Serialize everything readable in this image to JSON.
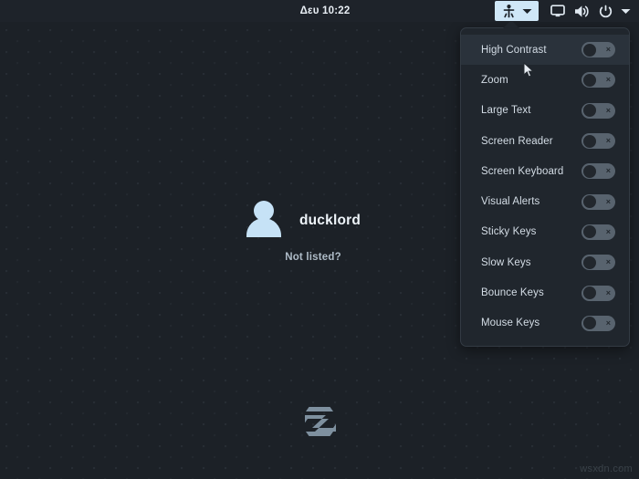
{
  "topbar": {
    "clock": "Δευ 10:22",
    "accessibility_button": {
      "icon": "accessibility-icon",
      "chevron": "chevron-down-icon",
      "active": true,
      "active_bg": "#cfe7f7"
    },
    "system_icons": [
      {
        "name": "display-icon",
        "label": "Display"
      },
      {
        "name": "volume-icon",
        "label": "Volume"
      },
      {
        "name": "power-icon",
        "label": "Power"
      },
      {
        "name": "chevron-down-icon",
        "label": "More"
      }
    ]
  },
  "accessibility_menu": {
    "visible": true,
    "items": [
      {
        "label": "High Contrast",
        "enabled": false,
        "hovered": true
      },
      {
        "label": "Zoom",
        "enabled": false,
        "hovered": false
      },
      {
        "label": "Large Text",
        "enabled": false,
        "hovered": false
      },
      {
        "label": "Screen Reader",
        "enabled": false,
        "hovered": false
      },
      {
        "label": "Screen Keyboard",
        "enabled": false,
        "hovered": false
      },
      {
        "label": "Visual Alerts",
        "enabled": false,
        "hovered": false
      },
      {
        "label": "Sticky Keys",
        "enabled": false,
        "hovered": false
      },
      {
        "label": "Slow Keys",
        "enabled": false,
        "hovered": false
      },
      {
        "label": "Bounce Keys",
        "enabled": false,
        "hovered": false
      },
      {
        "label": "Mouse Keys",
        "enabled": false,
        "hovered": false
      }
    ],
    "toggle_off_mark": "×"
  },
  "login": {
    "username": "ducklord",
    "not_listed_label": "Not listed?",
    "avatar_icon": "user-avatar-icon",
    "avatar_color": "#c6e2f6"
  },
  "branding": {
    "logo_icon": "zorin-logo-icon",
    "logo_color": "#7e909f"
  },
  "watermark": {
    "text": "wsxdn.com"
  },
  "theme": {
    "desktop_bg": "#1c2127",
    "topbar_bg": "#1e232a",
    "menu_bg": "#20262d",
    "menu_border": "#333b44",
    "menu_hover_bg": "#2a323b",
    "text_primary": "#eef4f9",
    "text_secondary": "#d4dde6",
    "text_muted": "#aebbc7",
    "accent": "#cfe7f7",
    "toggle_track": "#58636e"
  }
}
